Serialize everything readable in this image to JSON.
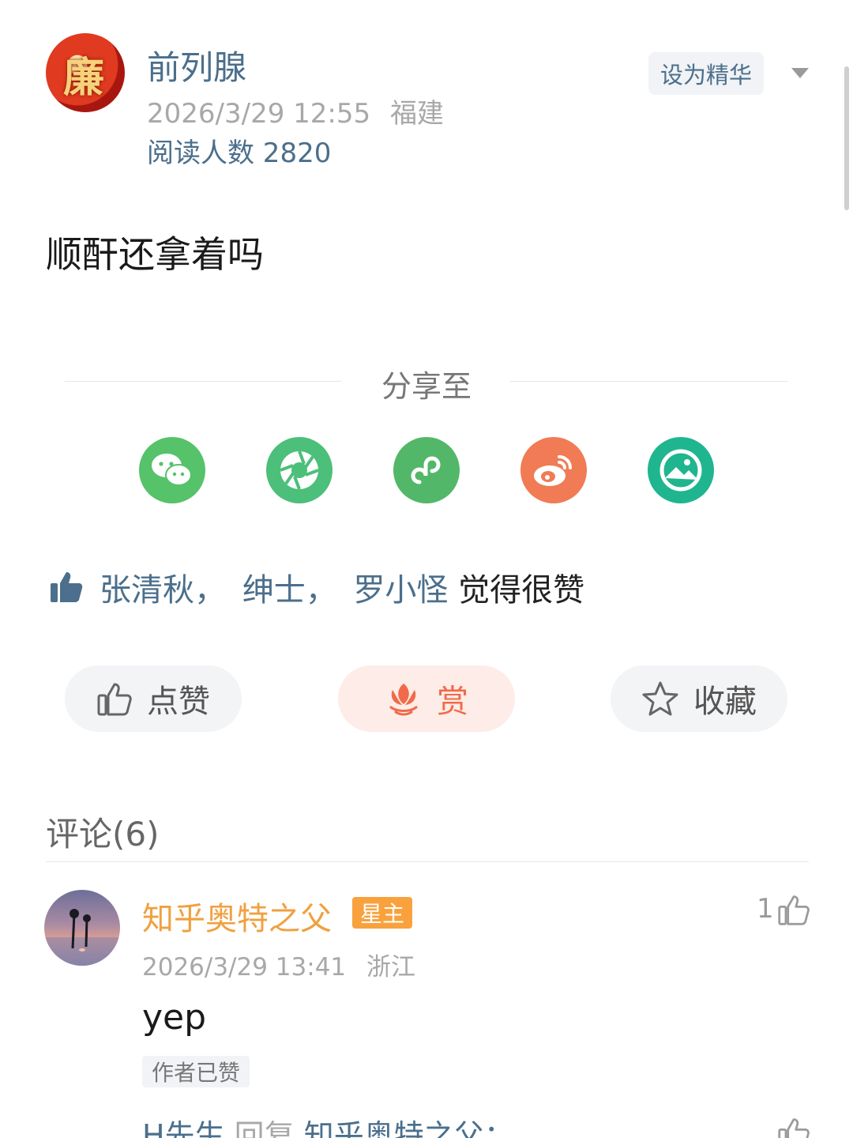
{
  "post": {
    "author": "前列腺",
    "avatar_text": "廉",
    "time": "2026/3/29 12:55",
    "location": "福建",
    "reads": "阅读人数 2820",
    "feature_label": "设为精华",
    "text": "顺酐还拿着吗"
  },
  "share": {
    "title": "分享至",
    "icons": [
      "wechat-icon",
      "moments-icon",
      "mini-program-icon",
      "weibo-icon",
      "image-share-icon"
    ]
  },
  "likes": {
    "names": [
      "张清秋，",
      "绅士，",
      "罗小怪"
    ],
    "suffix": " 觉得很赞"
  },
  "actions": {
    "like_label": "点赞",
    "reward_label": "赏",
    "favorite_label": "收藏"
  },
  "comments": {
    "title": "评论(6)",
    "items": [
      {
        "name": "知乎奥特之父",
        "badge": "星主",
        "time": "2026/3/29 13:41",
        "location": "浙江",
        "likes": "1",
        "text": "yep",
        "author_liked": "作者已赞"
      }
    ],
    "reply": {
      "from": "H先生",
      "verb": " 回复 ",
      "to": "知乎奥特之父："
    }
  },
  "colors": {
    "link": "#4b6f8c",
    "reward": "#ef6b4a",
    "name_orange": "#f0a040",
    "wechat": "#56c26a",
    "weibo": "#f07b55",
    "teal": "#1fb58f"
  }
}
